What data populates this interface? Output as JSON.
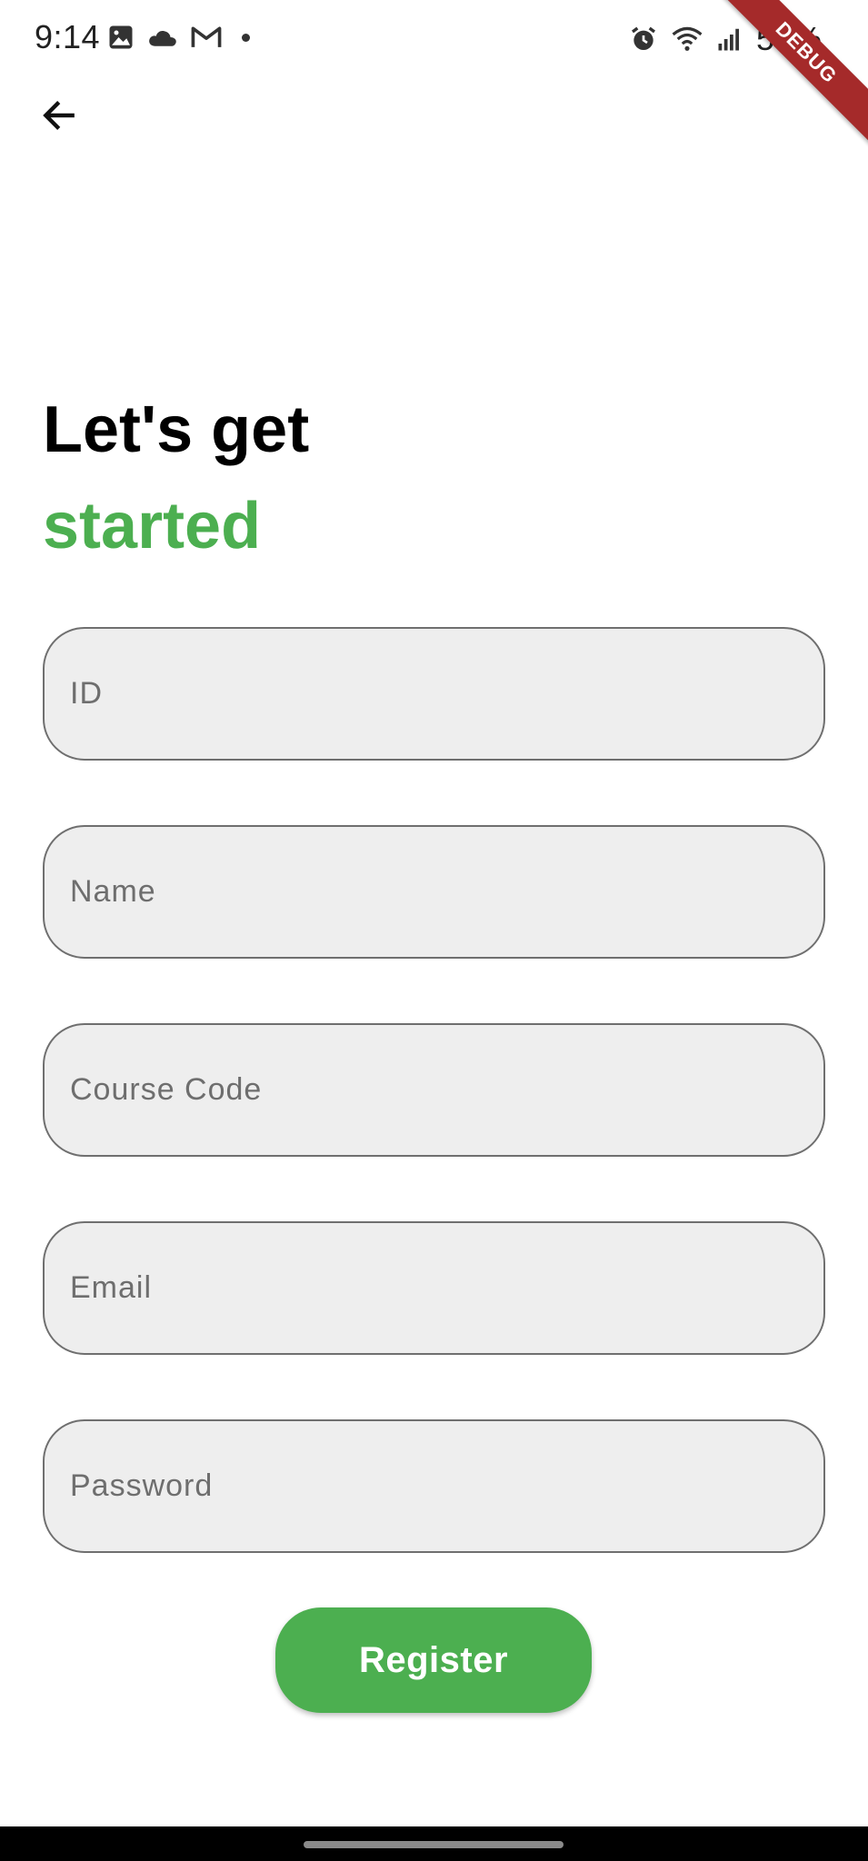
{
  "status_bar": {
    "time": "9:14",
    "battery": "50%",
    "left_icons": [
      "image-icon",
      "cloud-icon",
      "gmail-icon",
      "dot-icon"
    ],
    "right_icons": [
      "alarm-icon",
      "wifi-icon",
      "signal-icon"
    ]
  },
  "debug_banner": {
    "label": "DEBUG"
  },
  "header": {
    "back_icon": "arrow-left-icon"
  },
  "heading": {
    "line1": "Let's get",
    "line2": "started"
  },
  "form": {
    "id_placeholder": "ID",
    "name_placeholder": "Name",
    "course_code_placeholder": "Course Code",
    "email_placeholder": "Email",
    "password_placeholder": "Password",
    "id_value": "",
    "name_value": "",
    "course_code_value": "",
    "email_value": "",
    "password_value": ""
  },
  "actions": {
    "register_label": "Register"
  },
  "colors": {
    "accent": "#4caf50",
    "field_bg": "#eeeeee",
    "field_border": "#6f6f6f",
    "debug_banner": "#a52a2a"
  }
}
